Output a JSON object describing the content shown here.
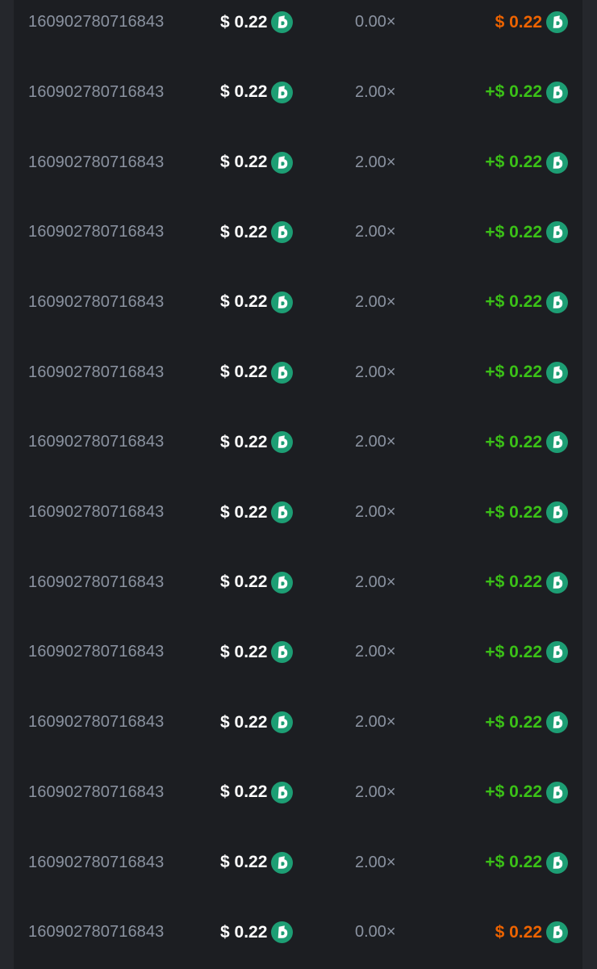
{
  "colors": {
    "page_background": "#25272c",
    "panel_background": "#1c1e22",
    "muted_text": "#8b93a1",
    "amount_text": "#ffffff",
    "profit_win": "#3bc117",
    "profit_loss": "#ed6300",
    "coin_green": "#1d9e74"
  },
  "icons": {
    "currency": "bc-coin-icon"
  },
  "bets": [
    {
      "bet_id": "160902780716843",
      "amount": "$ 0.22",
      "multiplier": "0.00×",
      "profit": "$ 0.22",
      "result": "loss"
    },
    {
      "bet_id": "160902780716843",
      "amount": "$ 0.22",
      "multiplier": "2.00×",
      "profit": "+$ 0.22",
      "result": "win"
    },
    {
      "bet_id": "160902780716843",
      "amount": "$ 0.22",
      "multiplier": "2.00×",
      "profit": "+$ 0.22",
      "result": "win"
    },
    {
      "bet_id": "160902780716843",
      "amount": "$ 0.22",
      "multiplier": "2.00×",
      "profit": "+$ 0.22",
      "result": "win"
    },
    {
      "bet_id": "160902780716843",
      "amount": "$ 0.22",
      "multiplier": "2.00×",
      "profit": "+$ 0.22",
      "result": "win"
    },
    {
      "bet_id": "160902780716843",
      "amount": "$ 0.22",
      "multiplier": "2.00×",
      "profit": "+$ 0.22",
      "result": "win"
    },
    {
      "bet_id": "160902780716843",
      "amount": "$ 0.22",
      "multiplier": "2.00×",
      "profit": "+$ 0.22",
      "result": "win"
    },
    {
      "bet_id": "160902780716843",
      "amount": "$ 0.22",
      "multiplier": "2.00×",
      "profit": "+$ 0.22",
      "result": "win"
    },
    {
      "bet_id": "160902780716843",
      "amount": "$ 0.22",
      "multiplier": "2.00×",
      "profit": "+$ 0.22",
      "result": "win"
    },
    {
      "bet_id": "160902780716843",
      "amount": "$ 0.22",
      "multiplier": "2.00×",
      "profit": "+$ 0.22",
      "result": "win"
    },
    {
      "bet_id": "160902780716843",
      "amount": "$ 0.22",
      "multiplier": "2.00×",
      "profit": "+$ 0.22",
      "result": "win"
    },
    {
      "bet_id": "160902780716843",
      "amount": "$ 0.22",
      "multiplier": "2.00×",
      "profit": "+$ 0.22",
      "result": "win"
    },
    {
      "bet_id": "160902780716843",
      "amount": "$ 0.22",
      "multiplier": "2.00×",
      "profit": "+$ 0.22",
      "result": "win"
    },
    {
      "bet_id": "160902780716843",
      "amount": "$ 0.22",
      "multiplier": "0.00×",
      "profit": "$ 0.22",
      "result": "loss"
    }
  ]
}
